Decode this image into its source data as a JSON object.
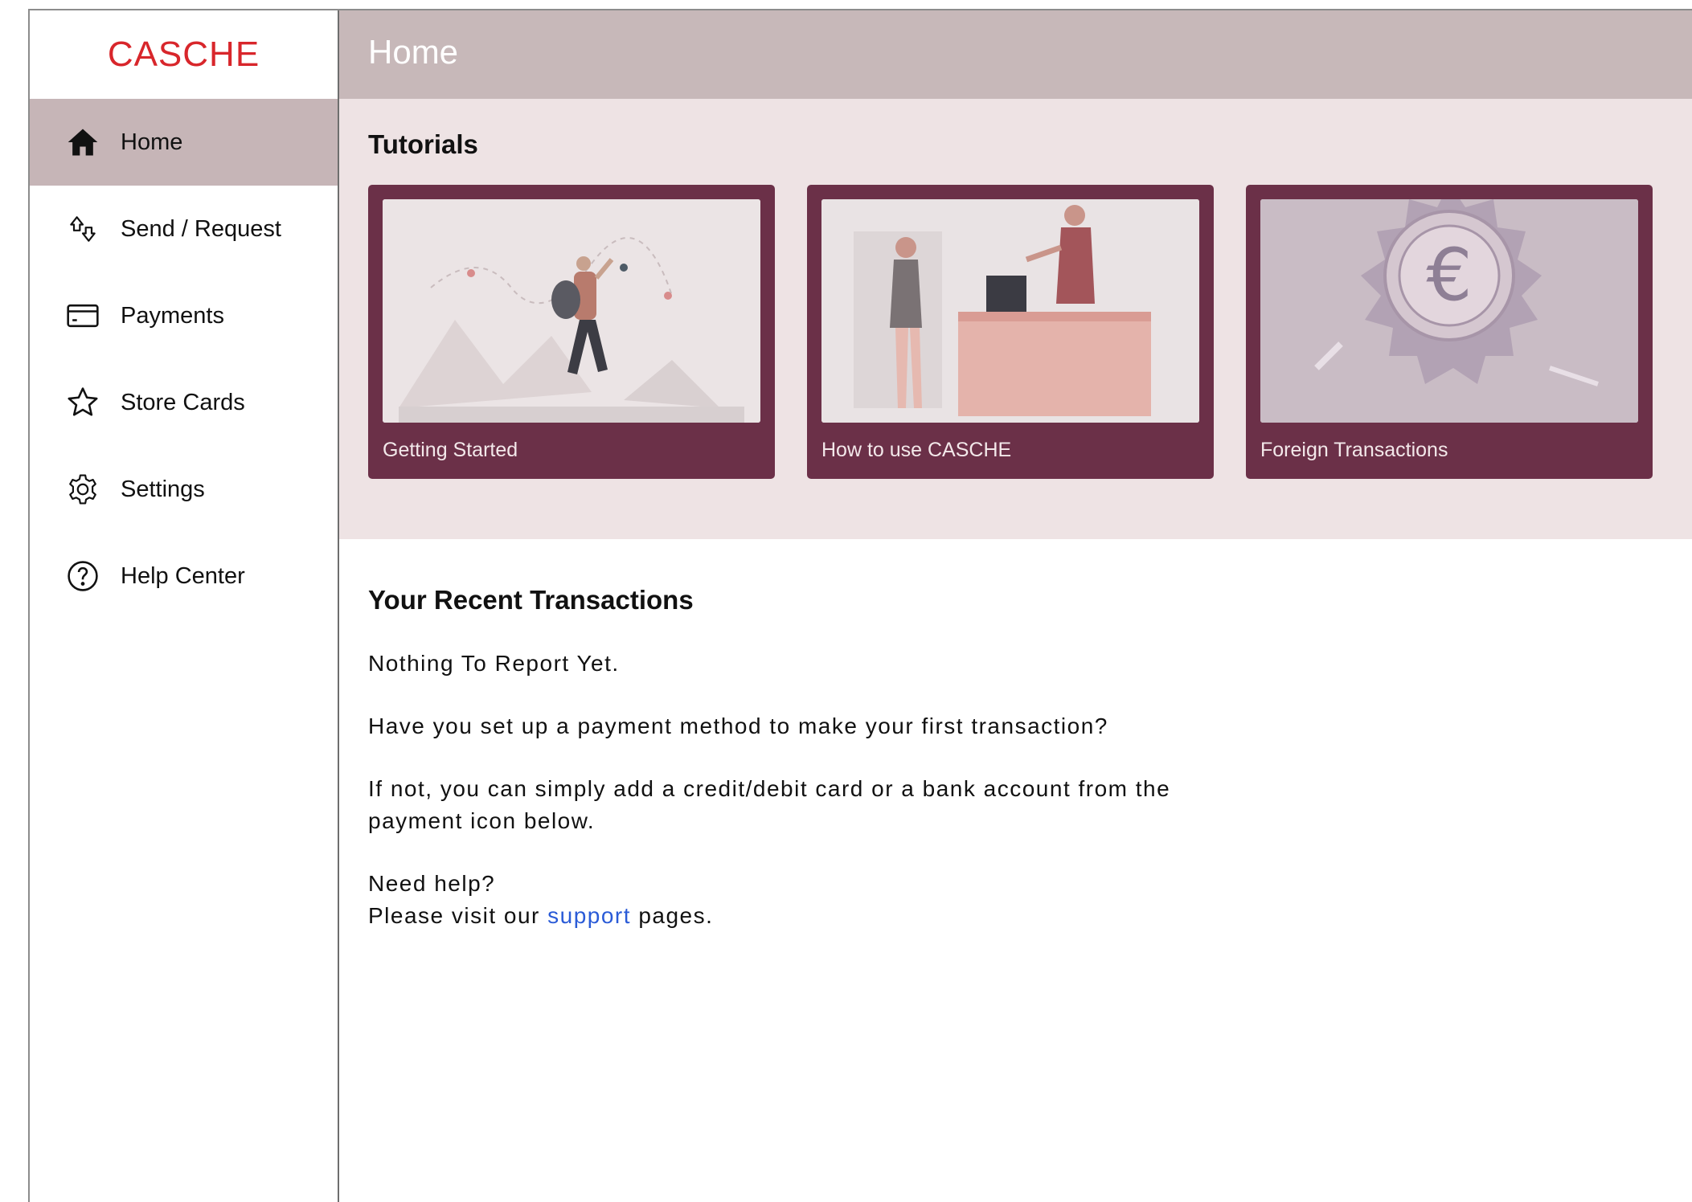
{
  "app": {
    "brand": "CASCHE",
    "brand_color": "#d8262b",
    "accent": "#6b3048"
  },
  "sidebar": {
    "items": [
      {
        "label": "Home",
        "icon": "home-icon",
        "active": true
      },
      {
        "label": "Send / Request",
        "icon": "transfer-arrows-icon",
        "active": false
      },
      {
        "label": "Payments",
        "icon": "credit-card-icon",
        "active": false
      },
      {
        "label": "Store Cards",
        "icon": "star-icon",
        "active": false
      },
      {
        "label": "Settings",
        "icon": "gear-icon",
        "active": false
      },
      {
        "label": "Help Center",
        "icon": "question-circle-icon",
        "active": false
      }
    ]
  },
  "header": {
    "title": "Home"
  },
  "tutorials": {
    "title": "Tutorials",
    "cards": [
      {
        "label": "Getting Started",
        "image": "hiker-illustration"
      },
      {
        "label": "How to use CASCHE",
        "image": "shop-counter-illustration"
      },
      {
        "label": "Foreign Transactions",
        "image": "euro-coin-illustration"
      }
    ]
  },
  "recent": {
    "title": "Your Recent Transactions",
    "empty": "Nothing To Report Yet.",
    "question": "Have you set up a payment method to make your first transaction?",
    "instructions_line1": "If not, you can simply add a credit/debit card or a bank account from the",
    "instructions_line2": "payment icon below.",
    "help_line": "Need help?",
    "visit_prefix": "Please visit our ",
    "support_link": "support",
    "visit_suffix": " pages."
  }
}
